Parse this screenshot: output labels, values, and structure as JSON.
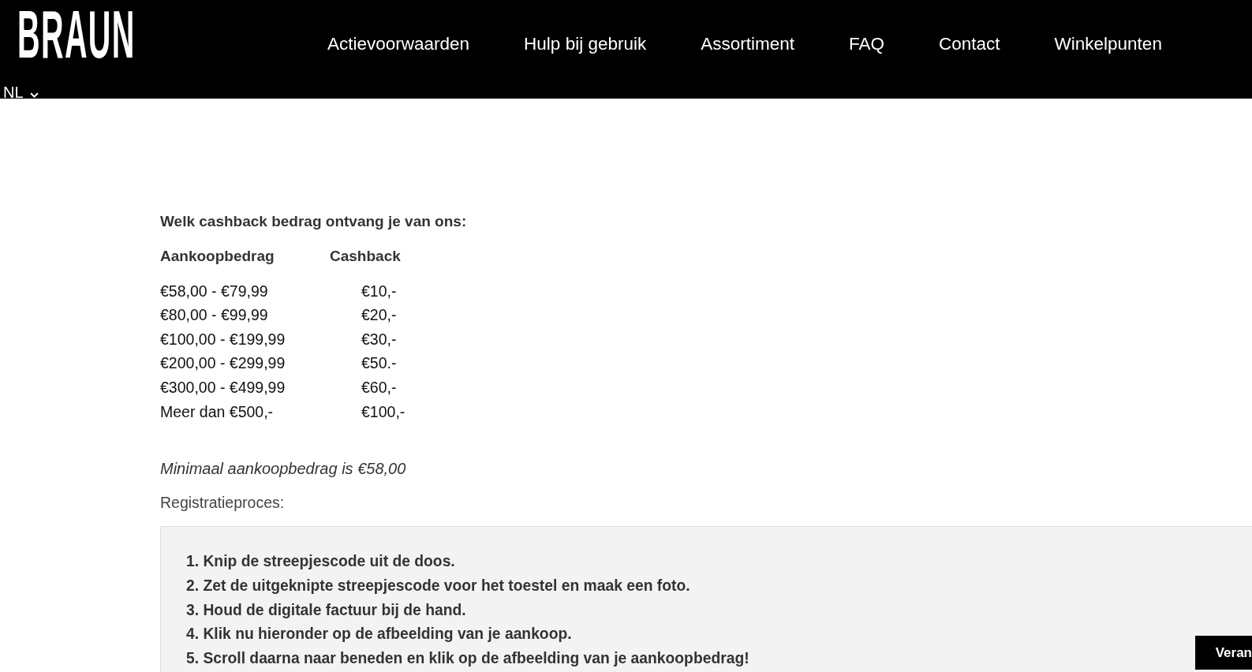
{
  "header": {
    "logo": "BRAUN",
    "nav": [
      {
        "label": "Actievoorwaarden"
      },
      {
        "label": "Hulp bij gebruik"
      },
      {
        "label": "Assortiment"
      },
      {
        "label": "FAQ"
      },
      {
        "label": "Contact"
      },
      {
        "label": "Winkelpunten"
      }
    ],
    "language": {
      "label": "NL"
    }
  },
  "content": {
    "heading": "Welk cashback bedrag ontvang je van ons:",
    "table": {
      "columns": [
        "Aankoopbedrag",
        "Cashback"
      ],
      "rows": [
        [
          "€58,00 - €79,99",
          "€10,-"
        ],
        [
          "€80,00 - €99,99",
          "€20,-"
        ],
        [
          "€100,00 - €199,99",
          "€30,-"
        ],
        [
          "€200,00 - €299,99",
          "€50.-"
        ],
        [
          "€300,00 - €499,99",
          "€60,-"
        ],
        [
          "Meer dan €500,-",
          "€100,-"
        ]
      ]
    },
    "note": "Minimaal aankoopbedrag is €58,00",
    "process_label": "Registratieproces:",
    "steps": [
      "1. Knip de streepjescode uit de doos.",
      "2. Zet de uitgeknipte streepjescode voor het toestel en maak een foto.",
      "3. Houd de digitale factuur bij de hand.",
      "4. Klik nu hieronder op de afbeelding van je aankoop.",
      "5. Scroll daarna naar beneden en klik op de afbeelding van je aankoopbedrag!"
    ]
  },
  "floating_button": {
    "label": "Veran"
  }
}
